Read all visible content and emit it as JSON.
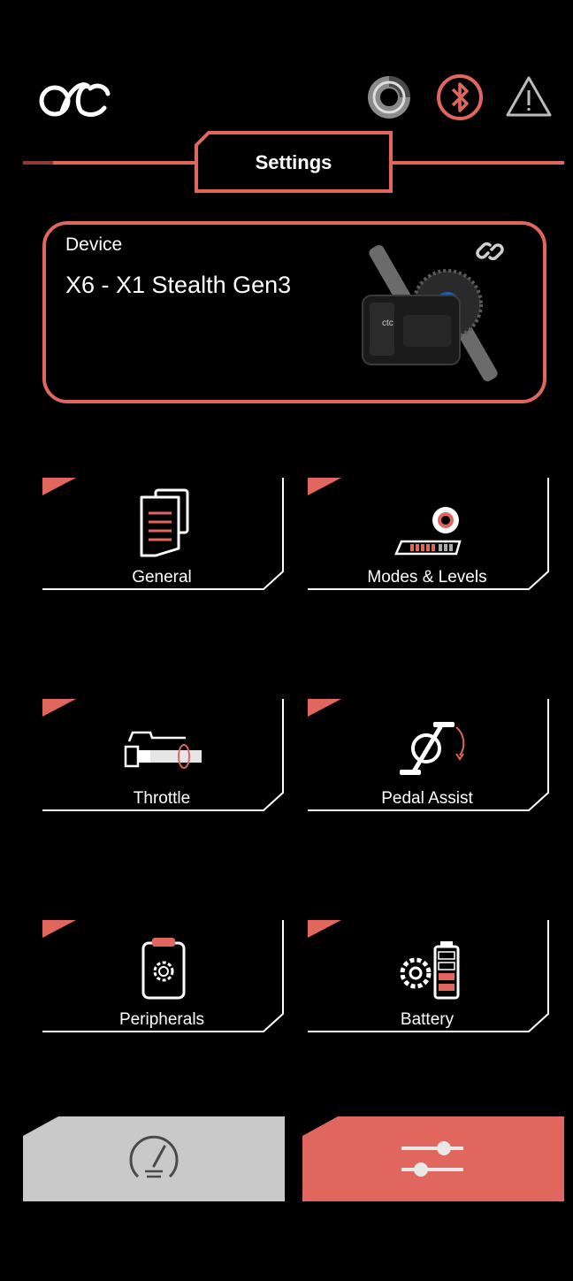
{
  "app": {
    "logo_icon": "ctc-logo-icon"
  },
  "status_bar": {
    "icons": [
      "brake-disc-icon",
      "bluetooth-icon",
      "warning-icon"
    ],
    "accent_color": "#e0665e"
  },
  "header": {
    "title": "Settings"
  },
  "device": {
    "label": "Device",
    "name": "X6 - X1 Stealth Gen3",
    "link_icon": "link-icon",
    "image": "motor-image"
  },
  "tiles": [
    {
      "label": "General",
      "icon": "document-icon"
    },
    {
      "label": "Modes & Levels",
      "icon": "level-slider-icon"
    },
    {
      "label": "Throttle",
      "icon": "throttle-icon"
    },
    {
      "label": "Pedal Assist",
      "icon": "pedal-crank-icon"
    },
    {
      "label": "Peripherals",
      "icon": "clipboard-gear-icon"
    },
    {
      "label": "Battery",
      "icon": "battery-gear-icon"
    }
  ],
  "bottom_nav": {
    "items": [
      {
        "icon": "dashboard-gauge-icon",
        "active": false
      },
      {
        "icon": "sliders-icon",
        "active": true
      }
    ],
    "active_color": "#e0665e",
    "inactive_color": "#c9c9c9"
  }
}
